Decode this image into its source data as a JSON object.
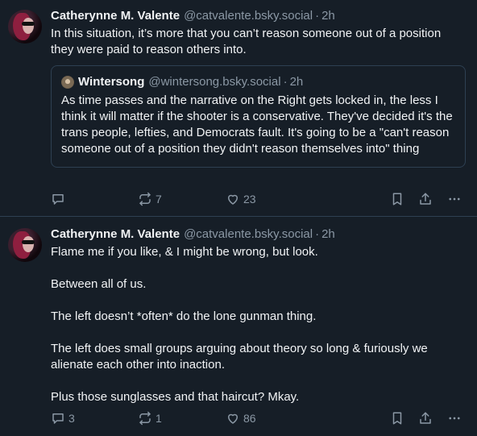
{
  "posts": [
    {
      "author": {
        "name": "Catherynne M. Valente",
        "handle": "@catvalente.bsky.social",
        "time": "2h"
      },
      "text": "In this situation, it’s more that you can’t reason someone out of a position they were paid to reason others into.",
      "quote": {
        "author": {
          "name": "Wintersong",
          "handle": "@wintersong.bsky.social",
          "time": "2h"
        },
        "text": "As time passes and the narrative on the Right gets locked in, the less I think it will matter if the shooter is a conservative. They've decided it's the trans people, lefties, and Democrats fault. It's going to be a \"can't reason someone out of a position they didn't reason themselves into\" thing"
      },
      "actions": {
        "reply_count": "",
        "repost_count": "7",
        "like_count": "23"
      }
    },
    {
      "author": {
        "name": "Catherynne M. Valente",
        "handle": "@catvalente.bsky.social",
        "time": "2h"
      },
      "text": "Flame me if you like, & I might be wrong, but look.\n\nBetween all of us.\n\nThe left doesn’t *often* do the lone gunman thing.\n\nThe left does small groups arguing about theory so long & furiously we alienate each other into inaction.\n\nPlus those sunglasses and that haircut? Mkay.",
      "actions": {
        "reply_count": "3",
        "repost_count": "1",
        "like_count": "86"
      }
    }
  ],
  "colors": {
    "background": "#161e27",
    "text": "#f1f3f5",
    "muted": "#8b98a5",
    "border": "#2e4052"
  },
  "icons": [
    "reply-icon",
    "repost-icon",
    "like-icon",
    "bookmark-icon",
    "share-icon",
    "more-icon"
  ]
}
